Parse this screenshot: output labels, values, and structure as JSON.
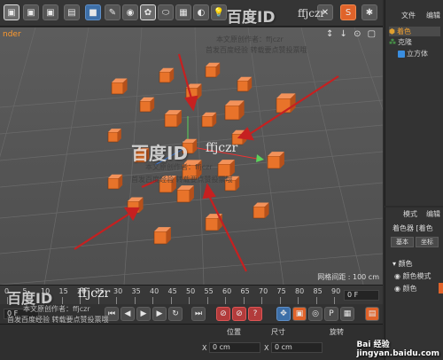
{
  "toolbar": {
    "icons": [
      "film-icon",
      "film-icon",
      "film-icon",
      "cube-icon",
      "pen-icon",
      "spline-icon",
      "nurbs-icon",
      "deformer-icon",
      "scene-icon",
      "grid-icon",
      "camera-icon",
      "light-icon",
      "render-icon",
      "script-icon",
      "python-icon",
      "close-icon"
    ]
  },
  "watermarks": {
    "brand": "百度ID",
    "user": "ffjczr",
    "line1": "本文原创作者：ffjczr",
    "line2": "首发百度经验 转载要点赞投票哦"
  },
  "viewport": {
    "label": "nder",
    "nav_icons": "↕ ↓ ⊙ ▢",
    "grid_readout": "网格间距 : 100 cm",
    "colors": {
      "cube": "#e8732a",
      "arrow": "#c62020",
      "axis_x": "#e33",
      "axis_y": "#5bd35b",
      "axis_z": "#3a7be0"
    }
  },
  "object_manager": {
    "menu": [
      "文件",
      "编辑"
    ],
    "tree": [
      {
        "name": "着色",
        "icon": "shader-icon",
        "highlight": true
      },
      {
        "name": "克隆",
        "icon": "cloner-icon",
        "highlight": false
      },
      {
        "name": "立方体",
        "icon": "cube-icon",
        "highlight": false
      }
    ]
  },
  "attributes": {
    "menu": [
      "模式",
      "编辑"
    ],
    "object_label": "着色器 [着色",
    "tabs": [
      "基本",
      "坐标"
    ],
    "section": "颜色",
    "params": [
      "颜色模式",
      "颜色"
    ]
  },
  "timeline": {
    "ticks": [
      "0",
      "5",
      "10",
      "15",
      "20",
      "25",
      "30",
      "35",
      "40",
      "45",
      "50",
      "55",
      "60",
      "65",
      "70",
      "75",
      "80",
      "85",
      "90"
    ],
    "current_frame": "0 F",
    "start_field": "0 F"
  },
  "coords": {
    "headers": [
      "位置",
      "尺寸",
      "旋转"
    ],
    "x_label": "X",
    "pos_x": "0 cm",
    "size_x": "0 cm"
  },
  "footer": {
    "site": "jingyan.baidu.com",
    "site_brand": "Bai 经验"
  }
}
